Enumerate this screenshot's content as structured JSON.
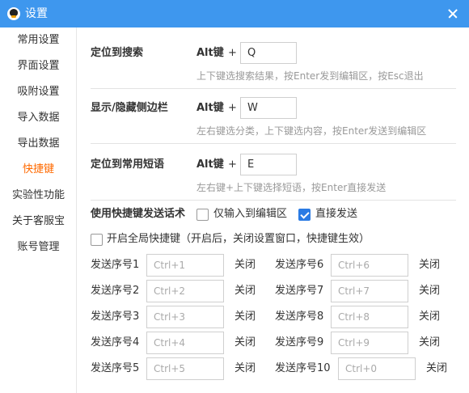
{
  "window": {
    "title": "设置",
    "close_icon": "close-icon",
    "logo_icon": "penguin-logo-icon"
  },
  "sidebar": {
    "items": [
      {
        "label": "常用设置",
        "active": false
      },
      {
        "label": "界面设置",
        "active": false
      },
      {
        "label": "吸附设置",
        "active": false
      },
      {
        "label": "导入数据",
        "active": false
      },
      {
        "label": "导出数据",
        "active": false
      },
      {
        "label": "快捷键",
        "active": true
      },
      {
        "label": "实验性功能",
        "active": false
      },
      {
        "label": "关于客服宝",
        "active": false
      },
      {
        "label": "账号管理",
        "active": false
      }
    ],
    "active_color": "#ff6a00"
  },
  "shortcuts": [
    {
      "label": "定位到搜索",
      "modifier": "Alt键",
      "plus": "+",
      "key": "Q",
      "hint": "上下键选搜索结果，按Enter发到编辑区，按Esc退出"
    },
    {
      "label": "显示/隐藏侧边栏",
      "modifier": "Alt键",
      "plus": "+",
      "key": "W",
      "hint": "左右键选分类，上下键选内容，按Enter发送到编辑区"
    },
    {
      "label": "定位到常用短语",
      "modifier": "Alt键",
      "plus": "+",
      "key": "E",
      "hint": "左右键+上下键选择短语，按Enter直接发送"
    }
  ],
  "send": {
    "label": "使用快捷键发送话术",
    "option_edit": {
      "label": "仅输入到编辑区",
      "checked": false
    },
    "option_send": {
      "label": "直接发送",
      "checked": true
    },
    "global": {
      "label": "开启全局快捷键（开启后，关闭设置窗口，快捷键生效）",
      "checked": false
    }
  },
  "send_rows": {
    "left": [
      {
        "label": "发送序号1",
        "placeholder": "Ctrl+1",
        "close": "关闭"
      },
      {
        "label": "发送序号2",
        "placeholder": "Ctrl+2",
        "close": "关闭"
      },
      {
        "label": "发送序号3",
        "placeholder": "Ctrl+3",
        "close": "关闭"
      },
      {
        "label": "发送序号4",
        "placeholder": "Ctrl+4",
        "close": "关闭"
      },
      {
        "label": "发送序号5",
        "placeholder": "Ctrl+5",
        "close": "关闭"
      }
    ],
    "right": [
      {
        "label": "发送序号6",
        "placeholder": "Ctrl+6",
        "close": "关闭"
      },
      {
        "label": "发送序号7",
        "placeholder": "Ctrl+7",
        "close": "关闭"
      },
      {
        "label": "发送序号8",
        "placeholder": "Ctrl+8",
        "close": "关闭"
      },
      {
        "label": "发送序号9",
        "placeholder": "Ctrl+9",
        "close": "关闭"
      },
      {
        "label": "发送序号10",
        "placeholder": "Ctrl+0",
        "close": "关闭"
      }
    ]
  },
  "colors": {
    "titlebar": "#3e97ee",
    "checkbox_checked": "#2a7be4",
    "active_tab": "#ff6a00"
  }
}
